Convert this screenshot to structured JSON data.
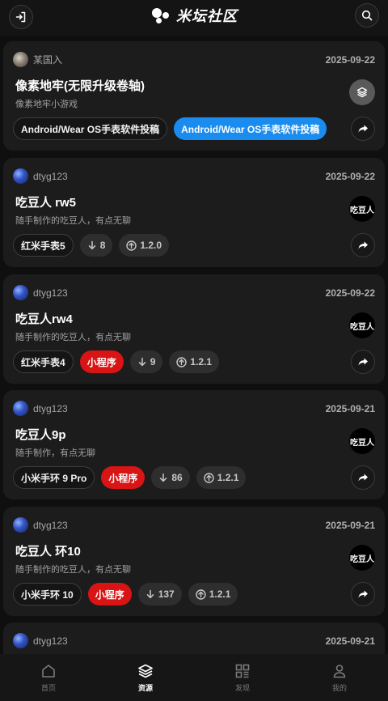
{
  "app": {
    "title": "米坛社区"
  },
  "header": {
    "login_icon": "login-icon",
    "search_icon": "search-icon"
  },
  "posts": [
    {
      "author": "某国入",
      "date": "2025-09-22",
      "title": "像素地牢(无限升级卷轴)",
      "desc": "像素地牢小游戏",
      "thumb": "",
      "tags": [
        "Android/Wear OS手表软件投稿",
        "Android/Wear OS手表软件投稿"
      ]
    },
    {
      "author": "dtyg123",
      "date": "2025-09-22",
      "title": "吃豆人 rw5",
      "desc": "随手制作的吃豆人，有点无聊",
      "thumb": "吃豆人",
      "tags": [
        "红米手表5"
      ],
      "downloads": "8",
      "version": "1.2.0"
    },
    {
      "author": "dtyg123",
      "date": "2025-09-22",
      "title": "吃豆人rw4",
      "desc": "随手制作的吃豆人，有点无聊",
      "thumb": "吃豆人",
      "tags": [
        "红米手表4",
        "小程序"
      ],
      "downloads": "9",
      "version": "1.2.1"
    },
    {
      "author": "dtyg123",
      "date": "2025-09-21",
      "title": "吃豆人9p",
      "desc": "随手制作，有点无聊",
      "thumb": "吃豆人",
      "tags": [
        "小米手环 9 Pro",
        "小程序"
      ],
      "downloads": "86",
      "version": "1.2.1"
    },
    {
      "author": "dtyg123",
      "date": "2025-09-21",
      "title": "吃豆人 环10",
      "desc": "随手制作的吃豆人，有点无聊",
      "thumb": "吃豆人",
      "tags": [
        "小米手环 10",
        "小程序"
      ],
      "downloads": "137",
      "version": "1.2.1"
    },
    {
      "author": "dtyg123",
      "date": "2025-09-21"
    }
  ],
  "nav": [
    {
      "label": "首页",
      "icon": "home-icon"
    },
    {
      "label": "资源",
      "icon": "layers-icon"
    },
    {
      "label": "发现",
      "icon": "discover-icon"
    },
    {
      "label": "我的",
      "icon": "user-icon"
    }
  ],
  "colors": {
    "accent_blue": "#1a8cf0",
    "accent_red": "#d81414",
    "background": "#0f0f0f",
    "card": "#1c1c1c"
  }
}
